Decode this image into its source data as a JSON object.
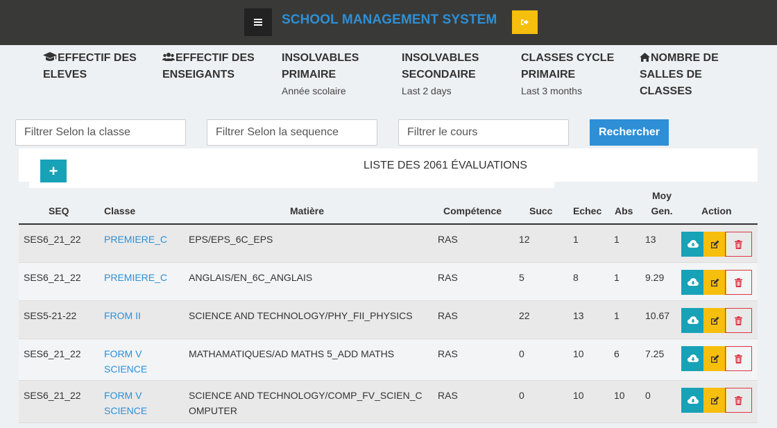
{
  "header": {
    "title": "SCHOOL MANAGEMENT SYSTEM"
  },
  "stats": [
    {
      "label": "EFFECTIF DES ELEVES",
      "sub": "",
      "icon": "graduation-cap-icon"
    },
    {
      "label": "EFFECTIF DES ENSEIGANTS",
      "sub": "",
      "icon": "users-icon"
    },
    {
      "label": "INSOLVABLES PRIMAIRE",
      "sub": "Année scolaire",
      "icon": ""
    },
    {
      "label": "INSOLVABLES SECONDAIRE",
      "sub": "Last 2 days",
      "icon": ""
    },
    {
      "label": "CLASSES CYCLE PRIMAIRE",
      "sub": "Last 3 months",
      "icon": ""
    },
    {
      "label": "NOMBRE DE SALLES DE CLASSES",
      "sub": "",
      "icon": "home-icon"
    }
  ],
  "filters": {
    "classe_placeholder": "Filtrer Selon la classe",
    "sequence_placeholder": "Filtrer Selon la sequence",
    "cours_placeholder": "Filtrer le cours",
    "search_label": "Rechercher"
  },
  "list": {
    "add_label": "+",
    "title": "LISTE DES 2061 ÉVALUATIONS"
  },
  "table": {
    "columns": {
      "seq": "SEQ",
      "classe": "Classe",
      "matiere": "Matière",
      "competence": "Compétence",
      "succ": "Succ",
      "echec": "Echec",
      "abs": "Abs",
      "moy": "Moy Gen.",
      "action": "Action"
    },
    "rows": [
      {
        "seq": "SES6_21_22",
        "classe": "PREMIERE_C",
        "matiere": "EPS/EPS_6C_EPS",
        "competence": "RAS",
        "succ": "12",
        "echec": "1",
        "abs": "1",
        "moy": "13"
      },
      {
        "seq": "SES6_21_22",
        "classe": "PREMIERE_C",
        "matiere": "ANGLAIS/EN_6C_ANGLAIS",
        "competence": "RAS",
        "succ": "5",
        "echec": "8",
        "abs": "1",
        "moy": "9.29"
      },
      {
        "seq": "SES5-21-22",
        "classe": "FROM II",
        "matiere": "SCIENCE AND TECHNOLOGY/PHY_FII_PHYSICS",
        "competence": "RAS",
        "succ": "22",
        "echec": "13",
        "abs": "1",
        "moy": "10.67"
      },
      {
        "seq": "SES6_21_22",
        "classe": "FORM V SCIENCE",
        "matiere": "MATHAMATIQUES/AD MATHS 5_ADD MATHS",
        "competence": "RAS",
        "succ": "0",
        "echec": "10",
        "abs": "6",
        "moy": "7.25"
      },
      {
        "seq": "SES6_21_22",
        "classe": "FORM V SCIENCE",
        "matiere": "SCIENCE AND TECHNOLOGY/COMP_FV_SCIEN_COMPUTER",
        "competence": "RAS",
        "succ": "0",
        "echec": "10",
        "abs": "10",
        "moy": "0"
      }
    ]
  },
  "colors": {
    "topbar": "#393a37",
    "brand": "#2e8fd6",
    "warning": "#f6be0d",
    "info": "#17a2b8",
    "danger": "#dc3545"
  }
}
